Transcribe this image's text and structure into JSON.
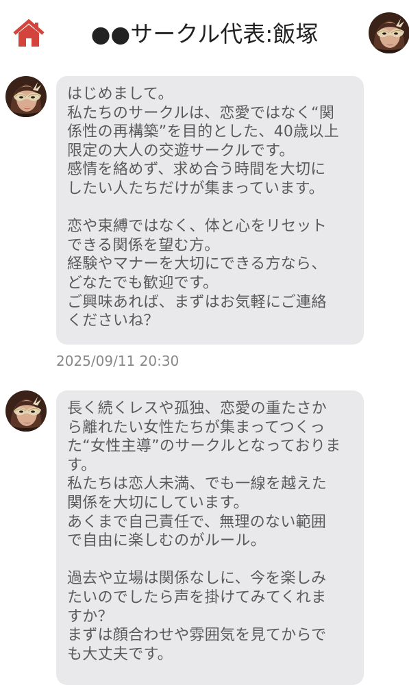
{
  "header": {
    "home_icon": "home-icon",
    "title": "●●サークル代表:飯塚",
    "avatar": "masked-woman-avatar"
  },
  "messages": [
    {
      "avatar": "masked-woman-avatar",
      "lines": [
        "はじめまして。",
        "私たちのサークルは、恋愛ではなく“関",
        "係性の再構築”を目的とした、40歳以上",
        "限定の大人の交遊サークルです。",
        "感情を絡めず、求め合う時間を大切に",
        "したい人たちだけが集まっています。",
        "",
        "恋や束縛ではなく、体と心をリセット",
        "できる関係を望む方。",
        "経験やマナーを大切にできる方なら、",
        "どなたでも歓迎です。",
        "ご興味あれば、まずはお気軽にご連絡",
        "くださいね？"
      ],
      "timestamp": "2025/09/11 20:30"
    },
    {
      "avatar": "masked-woman-avatar",
      "lines": [
        "長く続くレスや孤独、恋愛の重たさか",
        "ら離れたい女性たちが集まってつくっ",
        "た“女性主導”のサークルとなっておりま",
        "す。",
        "私たちは恋人未満、でも一線を越えた",
        "関係を大切にしています。",
        "あくまで自己責任で、無理のない範囲",
        "で自由に楽しむのがルール。",
        "",
        "過去や立場は関係なしに、今を楽しみ",
        "たいのでしたら声を掛けてみてくれま",
        "すか？",
        "まずは顔合わせや雰囲気を見てからで",
        "も大丈夫です。"
      ]
    }
  ],
  "colors": {
    "home_icon": "#d2443c",
    "bubble_bg": "#e9e9eb",
    "bubble_text": "#5a5a5a",
    "timestamp_text": "#888888",
    "title_text": "#222222"
  }
}
